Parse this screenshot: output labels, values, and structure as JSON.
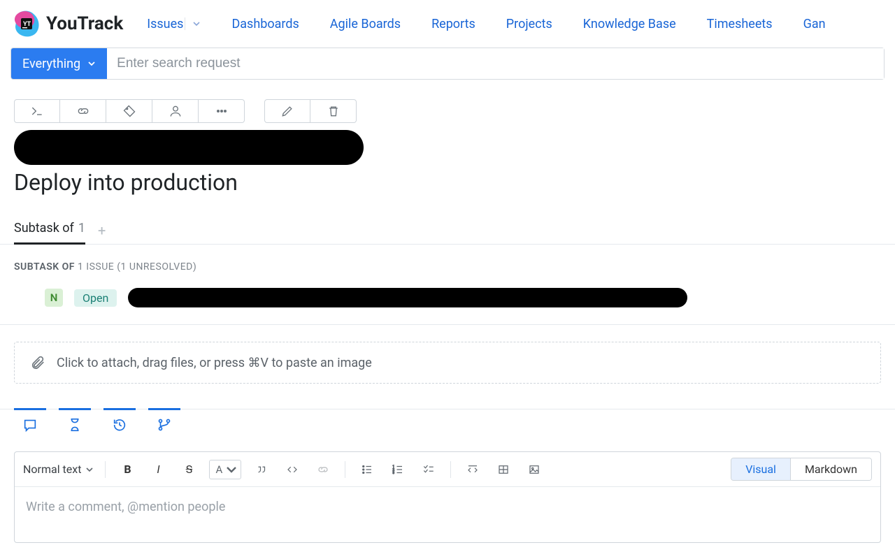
{
  "header": {
    "product_name": "YouTrack",
    "nav": {
      "issues": "Issues",
      "dashboards": "Dashboards",
      "agile_boards": "Agile Boards",
      "reports": "Reports",
      "projects": "Projects",
      "knowledge_base": "Knowledge Base",
      "timesheets": "Timesheets",
      "gantt": "Gan"
    }
  },
  "search": {
    "scope_label": "Everything",
    "placeholder": "Enter search request"
  },
  "issue": {
    "title": "Deploy into production"
  },
  "links": {
    "tab_label": "Subtask of",
    "tab_count": "1",
    "section_label": "SUBTASK OF",
    "section_meta": "1 ISSUE (1 UNRESOLVED)",
    "row": {
      "priority_letter": "N",
      "status": "Open"
    }
  },
  "attach": {
    "hint": "Click to attach, drag files, or press ⌘V to paste an image"
  },
  "editor": {
    "style_label": "Normal text",
    "color_letter": "A",
    "mode_visual": "Visual",
    "mode_markdown": "Markdown",
    "placeholder": "Write a comment, @mention people"
  }
}
